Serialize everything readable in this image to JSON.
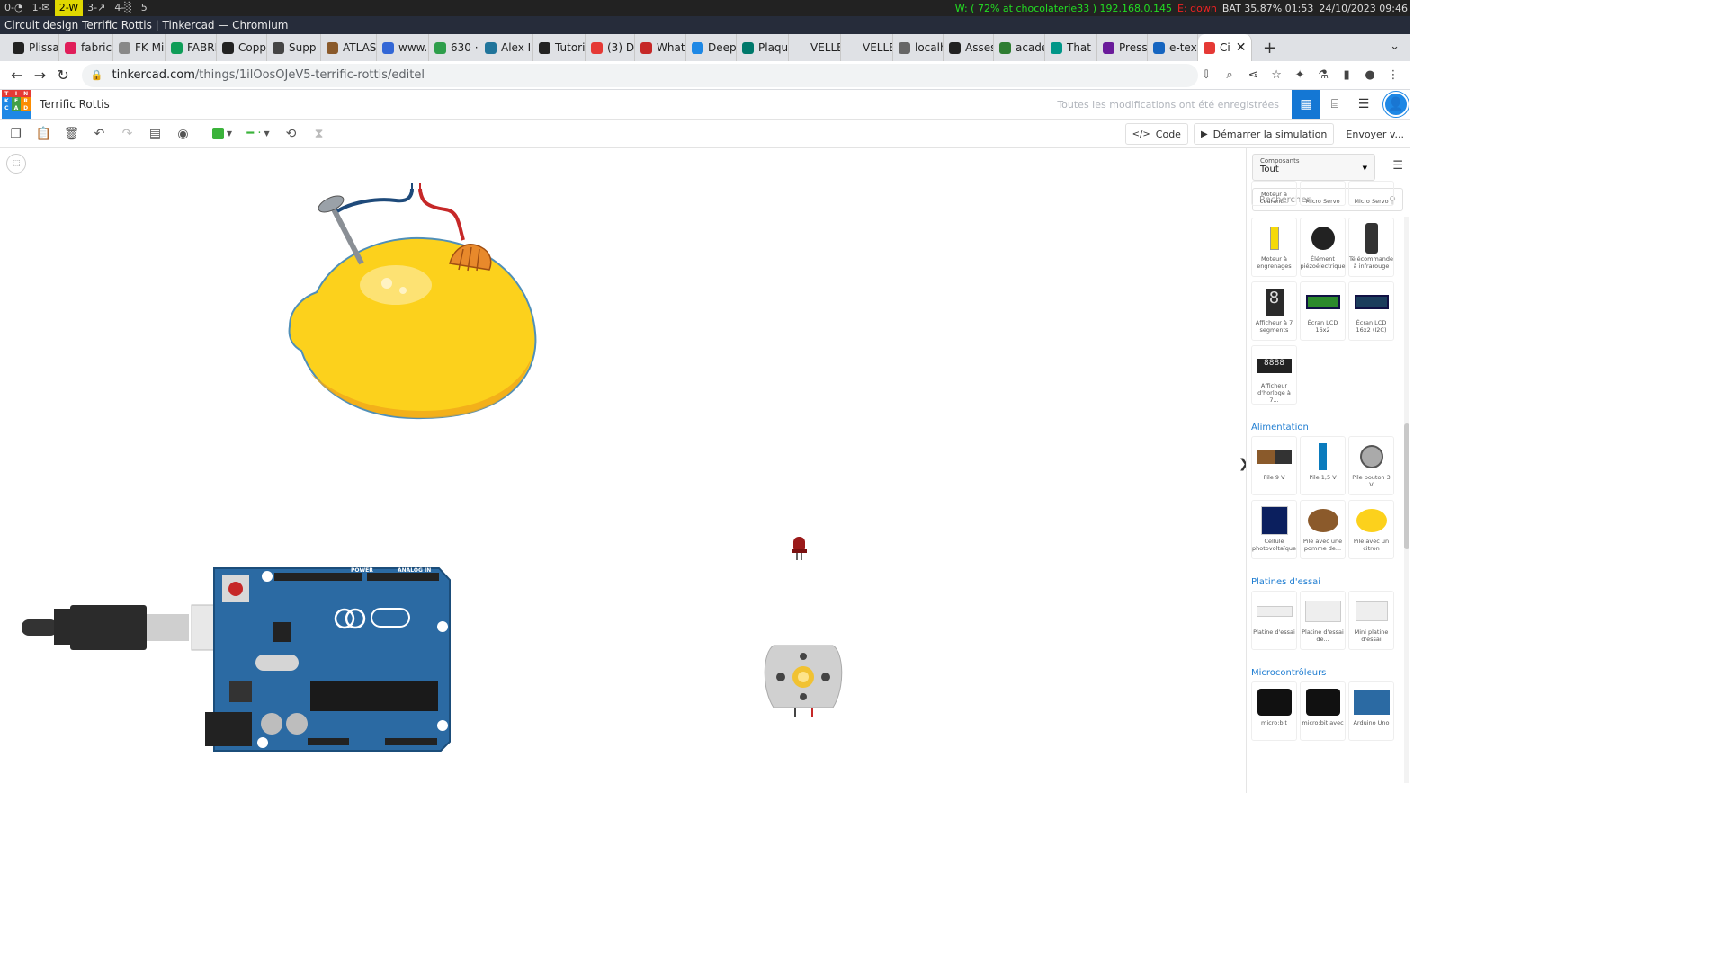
{
  "wm": {
    "workspaces": [
      "0-◔",
      "1-✉",
      "2-W",
      "3-↗",
      "4-░",
      "5"
    ],
    "wifi": "W: ( 72% at chocolaterie33 ) 192.168.0.145",
    "ethernet": "E: down",
    "battery": "BAT 35.87% 01:53",
    "datetime": "24/10/2023 09:46"
  },
  "window_title": "Circuit design Terrific Rottis | Tinkercad — Chromium",
  "tabs": [
    {
      "label": "Plissa",
      "color": "#222222"
    },
    {
      "label": "fabric",
      "color": "#e01e5a"
    },
    {
      "label": "FK Mi",
      "color": "#888888"
    },
    {
      "label": "FABRI",
      "color": "#0f9d58"
    },
    {
      "label": "Coppe",
      "color": "#222222"
    },
    {
      "label": "Supp",
      "color": "#444444"
    },
    {
      "label": "ATLAS",
      "color": "#8a5a2b"
    },
    {
      "label": "www.",
      "color": "#3367d6"
    },
    {
      "label": "630 ·",
      "color": "#2e9e4b"
    },
    {
      "label": "Alex I",
      "color": "#21759b"
    },
    {
      "label": "Tutori",
      "color": "#222222"
    },
    {
      "label": "(3) D",
      "color": "#e53935"
    },
    {
      "label": "What",
      "color": "#c62828"
    },
    {
      "label": "Deep",
      "color": "#1e88e5"
    },
    {
      "label": "Plaqu",
      "color": "#00796b"
    },
    {
      "label": "VELLE",
      "color": "#dfe1e5"
    },
    {
      "label": "VELLE",
      "color": "#dfe1e5"
    },
    {
      "label": "localh",
      "color": "#666666"
    },
    {
      "label": "Asses",
      "color": "#222222"
    },
    {
      "label": "acade",
      "color": "#2e7d32"
    },
    {
      "label": "That",
      "color": "#009688"
    },
    {
      "label": "Press",
      "color": "#6a1b9a"
    },
    {
      "label": "e-tex",
      "color": "#1565c0"
    },
    {
      "label": "Ci",
      "color": "#e53935"
    }
  ],
  "url": {
    "host": "tinkercad.com",
    "path": "/things/1ilOosOJeV5-terrific-rottis/editel"
  },
  "logo_letters": [
    "T",
    "I",
    "N",
    "K",
    "E",
    "R",
    "C",
    "A",
    "D",
    "",
    "",
    ""
  ],
  "header": {
    "title": "Terrific Rottis",
    "saved": "Toutes les modifications ont été enregistrées"
  },
  "toolbar": {
    "code": "Code",
    "simulate": "Démarrer la simulation",
    "send": "Envoyer v..."
  },
  "sidebar": {
    "category_label": "Composants",
    "category_value": "Tout",
    "search_placeholder": "Rechercher",
    "top_row": [
      "Moteur à courant...",
      "Micro Servo",
      "Micro Servo"
    ],
    "output_parts": [
      "Moteur à engrenages",
      "Élément piézoélectrique",
      "Télécommande à infrarouge",
      "Afficheur à 7 segments",
      "Écran LCD 16x2",
      "Écran LCD 16x2 (I2C)",
      "Afficheur d'horloge à 7..."
    ],
    "sections": [
      {
        "title": "Alimentation",
        "parts": [
          "Pile 9 V",
          "Pile 1,5 V",
          "Pile bouton 3 V",
          "Cellule photovoltaïque",
          "Pile avec une pomme de...",
          "Pile avec un citron"
        ]
      },
      {
        "title": "Platines d'essai",
        "parts": [
          "Platine d'essai",
          "Platine d'essai de...",
          "Mini platine d'essai"
        ]
      },
      {
        "title": "Microcontrôleurs",
        "parts": [
          "micro:bit",
          "micro:bit avec",
          "Arduino Uno"
        ]
      }
    ]
  },
  "arduino": {
    "brand": "ARDUINO",
    "model": "UNO",
    "digital": "DIGITAL (PWM~)",
    "power": "POWER",
    "analog": "ANALOG IN",
    "on": "ON",
    "tx": "TX",
    "rx": "RX",
    "l": "L"
  }
}
